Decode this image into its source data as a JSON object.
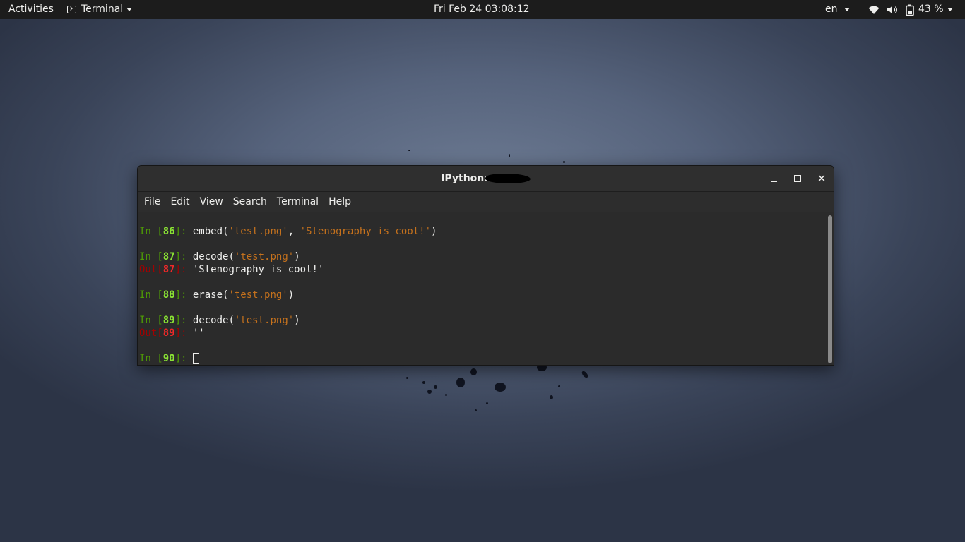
{
  "topbar": {
    "activities": "Activities",
    "app_menu": "Terminal",
    "clock": "Fri Feb 24  03:08:12",
    "language": "en",
    "battery": "43 %",
    "icons": [
      "wifi-icon",
      "volume-icon",
      "battery-icon"
    ]
  },
  "window": {
    "title": "IPython:",
    "menu": [
      "File",
      "Edit",
      "View",
      "Search",
      "Terminal",
      "Help"
    ]
  },
  "terminal": {
    "lines": [
      {
        "kind": "in",
        "num": "86",
        "parts": [
          {
            "t": "code",
            "v": "embed("
          },
          {
            "t": "str",
            "v": "'test.png'"
          },
          {
            "t": "code",
            "v": ", "
          },
          {
            "t": "str",
            "v": "'Stenography is cool!'"
          },
          {
            "t": "code",
            "v": ")"
          }
        ]
      },
      {
        "kind": "in",
        "num": "87",
        "parts": [
          {
            "t": "code",
            "v": "decode("
          },
          {
            "t": "str",
            "v": "'test.png'"
          },
          {
            "t": "code",
            "v": ")"
          }
        ]
      },
      {
        "kind": "out",
        "num": "87",
        "parts": [
          {
            "t": "code",
            "v": "'Stenography is cool!'"
          }
        ]
      },
      {
        "kind": "in",
        "num": "88",
        "parts": [
          {
            "t": "code",
            "v": "erase("
          },
          {
            "t": "str",
            "v": "'test.png'"
          },
          {
            "t": "code",
            "v": ")"
          }
        ]
      },
      {
        "kind": "in",
        "num": "89",
        "parts": [
          {
            "t": "code",
            "v": "decode("
          },
          {
            "t": "str",
            "v": "'test.png'"
          },
          {
            "t": "code",
            "v": ")"
          }
        ]
      },
      {
        "kind": "out",
        "num": "89",
        "parts": [
          {
            "t": "code",
            "v": "''"
          }
        ]
      },
      {
        "kind": "in",
        "num": "90",
        "parts": [],
        "cursor": true
      }
    ]
  },
  "colors": {
    "prompt_in": "#4e9a06",
    "prompt_in_num": "#8ae234",
    "prompt_out": "#a40000",
    "prompt_out_num": "#ef2929",
    "string": "#c4711d"
  }
}
